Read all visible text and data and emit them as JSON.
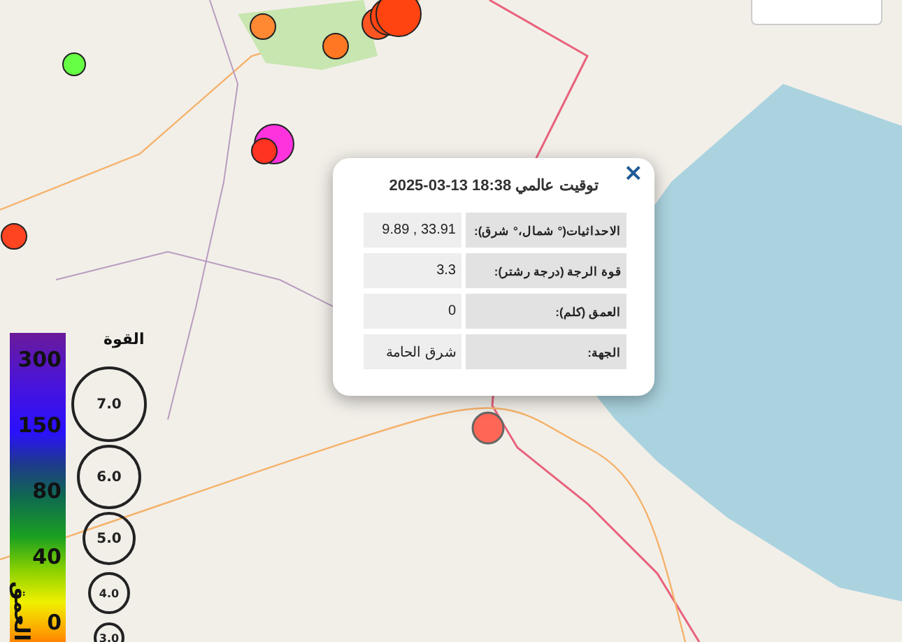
{
  "markers": [
    {
      "color": "#66ff44",
      "selected": false
    },
    {
      "color": "#ff8833",
      "selected": false
    },
    {
      "color": "#ff7722",
      "selected": false
    },
    {
      "color": "#ff5522",
      "selected": false
    },
    {
      "color": "#ff4411",
      "selected": false
    },
    {
      "color": "#ff4411",
      "selected": false
    },
    {
      "color": "#ff33dd",
      "selected": false
    },
    {
      "color": "#ff3322",
      "selected": false
    },
    {
      "color": "#ff4422",
      "selected": false
    },
    {
      "color": "#ff6655",
      "selected": true
    }
  ],
  "popup": {
    "title": "2025-03-13 18:38 توقيت عالمي",
    "close": "×",
    "rows": [
      {
        "label": "الاحداثيات(° شمال،° شرق):",
        "value": "9.89 , 33.91"
      },
      {
        "label": "قوة الرجة (درجة رشتر):",
        "value": "3.3"
      },
      {
        "label": "العمق (كلم):",
        "value": "0"
      },
      {
        "label": "الجهة:",
        "value": "شرق الحامة"
      }
    ]
  },
  "legend": {
    "depth": {
      "title": "العمق",
      "ticks": [
        "300",
        "150",
        "80",
        "40",
        "0"
      ]
    },
    "magnitude": {
      "title": "القوة",
      "sizes": [
        "7.0",
        "6.0",
        "5.0",
        "4.0",
        "3.0"
      ]
    }
  }
}
